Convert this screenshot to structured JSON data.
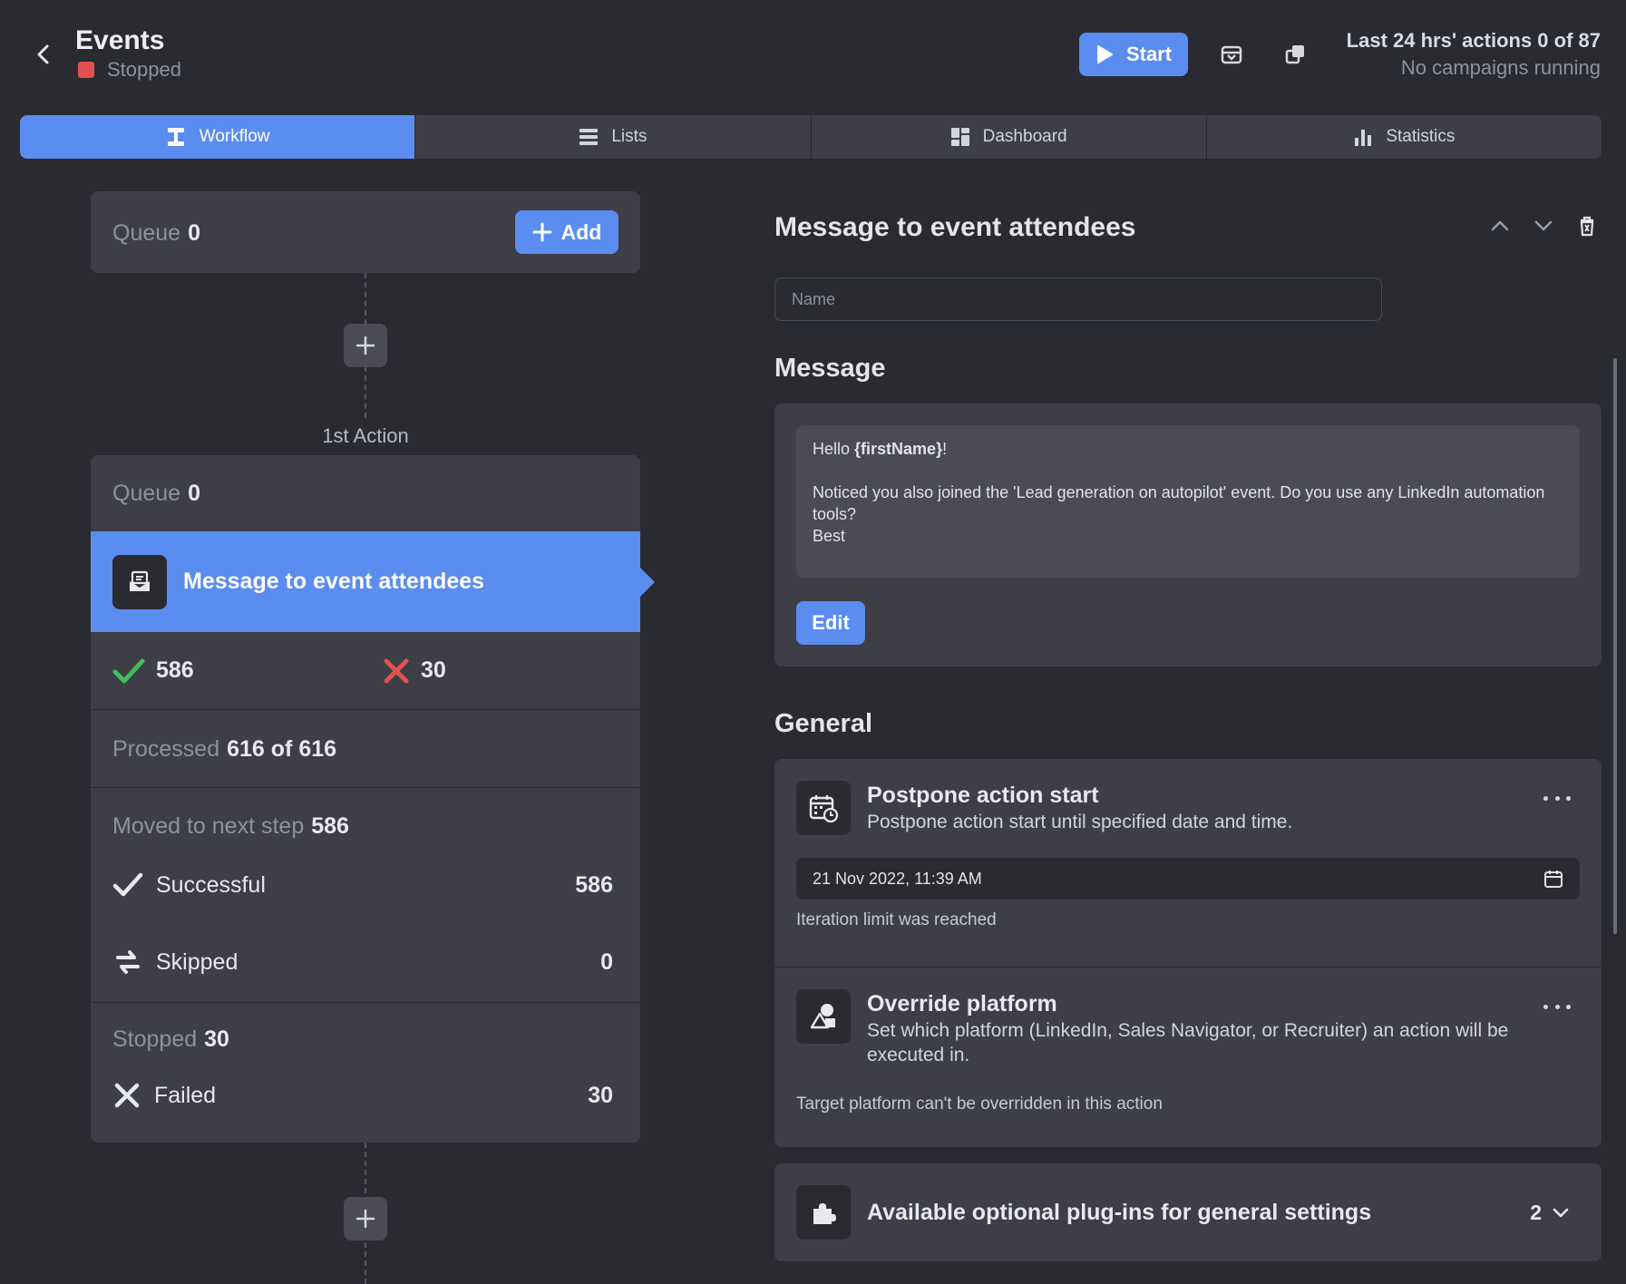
{
  "header": {
    "title": "Events",
    "status": "Stopped",
    "start_label": "Start",
    "limits_main": "Last 24 hrs' actions 0 of 87",
    "limits_sub": "No campaigns running"
  },
  "tabs": [
    {
      "label": "Workflow",
      "icon": "workflow-icon",
      "active": true
    },
    {
      "label": "Lists",
      "icon": "list-icon",
      "active": false
    },
    {
      "label": "Dashboard",
      "icon": "dashboard-icon",
      "active": false
    },
    {
      "label": "Statistics",
      "icon": "bar-chart-icon",
      "active": false
    }
  ],
  "workflow": {
    "queue": {
      "label": "Queue",
      "count": "0"
    },
    "add_label": "Add",
    "action_label": "1st Action",
    "action": {
      "queue_label": "Queue",
      "queue_count": "0",
      "title": "Message to event attendees",
      "success_count": "586",
      "fail_count": "30",
      "processed_label": "Processed",
      "processed_value": "616 of 616",
      "moved_label": "Moved to next step",
      "moved_value": "586",
      "successful_label": "Successful",
      "successful_value": "586",
      "skipped_label": "Skipped",
      "skipped_value": "0",
      "stopped_label": "Stopped",
      "stopped_value": "30",
      "failed_label": "Failed",
      "failed_value": "30"
    }
  },
  "detail": {
    "title": "Message to event attendees",
    "name_placeholder": "Name",
    "message_section": "Message",
    "message": {
      "greeting_prefix": "Hello ",
      "greeting_var": "{firstName}",
      "greeting_suffix": "!",
      "body": "Noticed you also joined the 'Lead generation on autopilot' event. Do you use any LinkedIn automation tools?",
      "signoff": "Best"
    },
    "edit_label": "Edit",
    "general_section": "General",
    "postpone": {
      "title": "Postpone action start",
      "desc": "Postpone action start until specified date and time.",
      "date": "21 Nov 2022, 11:39 AM",
      "note": "Iteration limit was reached"
    },
    "override": {
      "title": "Override platform",
      "desc": "Set which platform (LinkedIn, Sales Navigator, or Recruiter) an action will be executed in.",
      "note": "Target platform can't be overridden in this action"
    },
    "plugins": {
      "title": "Available optional plug-ins for general settings",
      "count": "2"
    }
  },
  "colors": {
    "background": "#2a2b31",
    "panel": "#3d3e46",
    "accent": "#5b8cf0",
    "stopped": "#e0514f",
    "success": "#3fbf5a",
    "error": "#e0514f"
  }
}
